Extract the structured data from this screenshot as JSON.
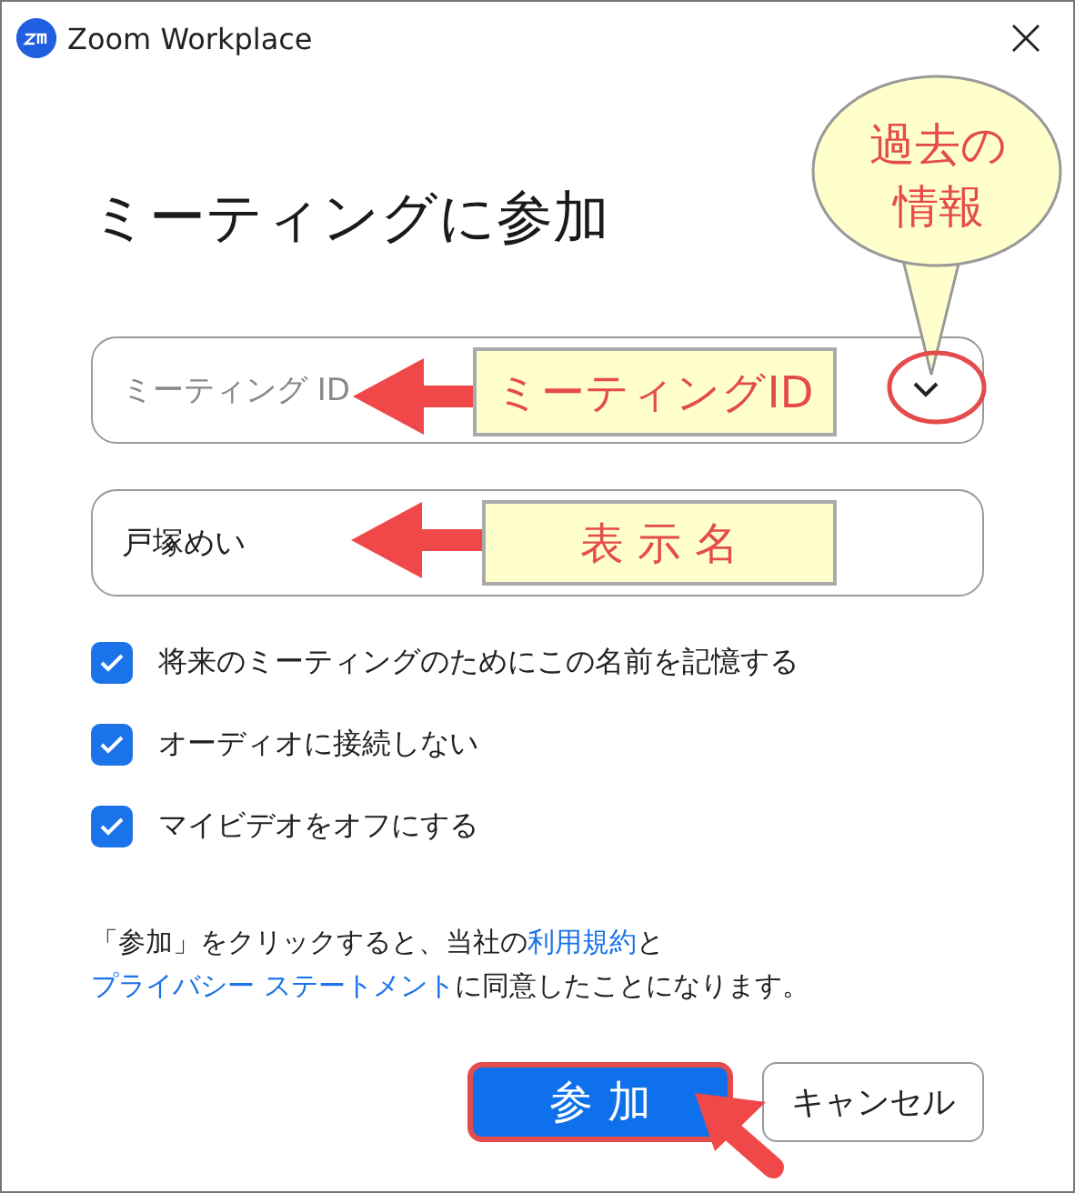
{
  "window": {
    "title": "Zoom Workplace"
  },
  "heading": "ミーティングに参加",
  "meeting_id_field": {
    "placeholder": "ミーティング ID",
    "dropdown": true
  },
  "name_field": {
    "value": "戸塚めい"
  },
  "options": [
    {
      "label": "将来のミーティングのためにこの名前を記憶する",
      "checked": true
    },
    {
      "label": "オーディオに接続しない",
      "checked": true
    },
    {
      "label": "マイビデオをオフにする",
      "checked": true
    }
  ],
  "terms": [
    {
      "kind": "text",
      "text": "「参加」をクリックすると、当社の"
    },
    {
      "kind": "link",
      "text": "利用規約"
    },
    {
      "kind": "text",
      "text": "と"
    },
    {
      "kind": "link",
      "text": "プライバシー ステートメント"
    },
    {
      "kind": "text",
      "text": "に同意したことになります。"
    }
  ],
  "buttons": [
    {
      "label": "参 加",
      "kind": "primary"
    },
    {
      "label": "キャンセル",
      "kind": "secondary"
    }
  ],
  "annotations": {
    "callout": [
      "過去の",
      "情報"
    ],
    "labels": [
      "ミーティングID",
      "表 示 名"
    ]
  }
}
